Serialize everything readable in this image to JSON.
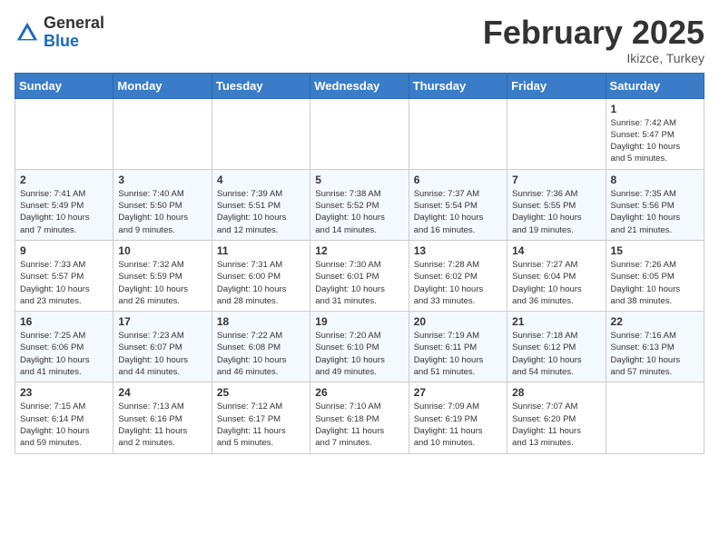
{
  "header": {
    "logo_general": "General",
    "logo_blue": "Blue",
    "month_title": "February 2025",
    "location": "Ikizce, Turkey"
  },
  "weekdays": [
    "Sunday",
    "Monday",
    "Tuesday",
    "Wednesday",
    "Thursday",
    "Friday",
    "Saturday"
  ],
  "weeks": [
    [
      {
        "day": "",
        "info": ""
      },
      {
        "day": "",
        "info": ""
      },
      {
        "day": "",
        "info": ""
      },
      {
        "day": "",
        "info": ""
      },
      {
        "day": "",
        "info": ""
      },
      {
        "day": "",
        "info": ""
      },
      {
        "day": "1",
        "info": "Sunrise: 7:42 AM\nSunset: 5:47 PM\nDaylight: 10 hours\nand 5 minutes."
      }
    ],
    [
      {
        "day": "2",
        "info": "Sunrise: 7:41 AM\nSunset: 5:49 PM\nDaylight: 10 hours\nand 7 minutes."
      },
      {
        "day": "3",
        "info": "Sunrise: 7:40 AM\nSunset: 5:50 PM\nDaylight: 10 hours\nand 9 minutes."
      },
      {
        "day": "4",
        "info": "Sunrise: 7:39 AM\nSunset: 5:51 PM\nDaylight: 10 hours\nand 12 minutes."
      },
      {
        "day": "5",
        "info": "Sunrise: 7:38 AM\nSunset: 5:52 PM\nDaylight: 10 hours\nand 14 minutes."
      },
      {
        "day": "6",
        "info": "Sunrise: 7:37 AM\nSunset: 5:54 PM\nDaylight: 10 hours\nand 16 minutes."
      },
      {
        "day": "7",
        "info": "Sunrise: 7:36 AM\nSunset: 5:55 PM\nDaylight: 10 hours\nand 19 minutes."
      },
      {
        "day": "8",
        "info": "Sunrise: 7:35 AM\nSunset: 5:56 PM\nDaylight: 10 hours\nand 21 minutes."
      }
    ],
    [
      {
        "day": "9",
        "info": "Sunrise: 7:33 AM\nSunset: 5:57 PM\nDaylight: 10 hours\nand 23 minutes."
      },
      {
        "day": "10",
        "info": "Sunrise: 7:32 AM\nSunset: 5:59 PM\nDaylight: 10 hours\nand 26 minutes."
      },
      {
        "day": "11",
        "info": "Sunrise: 7:31 AM\nSunset: 6:00 PM\nDaylight: 10 hours\nand 28 minutes."
      },
      {
        "day": "12",
        "info": "Sunrise: 7:30 AM\nSunset: 6:01 PM\nDaylight: 10 hours\nand 31 minutes."
      },
      {
        "day": "13",
        "info": "Sunrise: 7:28 AM\nSunset: 6:02 PM\nDaylight: 10 hours\nand 33 minutes."
      },
      {
        "day": "14",
        "info": "Sunrise: 7:27 AM\nSunset: 6:04 PM\nDaylight: 10 hours\nand 36 minutes."
      },
      {
        "day": "15",
        "info": "Sunrise: 7:26 AM\nSunset: 6:05 PM\nDaylight: 10 hours\nand 38 minutes."
      }
    ],
    [
      {
        "day": "16",
        "info": "Sunrise: 7:25 AM\nSunset: 6:06 PM\nDaylight: 10 hours\nand 41 minutes."
      },
      {
        "day": "17",
        "info": "Sunrise: 7:23 AM\nSunset: 6:07 PM\nDaylight: 10 hours\nand 44 minutes."
      },
      {
        "day": "18",
        "info": "Sunrise: 7:22 AM\nSunset: 6:08 PM\nDaylight: 10 hours\nand 46 minutes."
      },
      {
        "day": "19",
        "info": "Sunrise: 7:20 AM\nSunset: 6:10 PM\nDaylight: 10 hours\nand 49 minutes."
      },
      {
        "day": "20",
        "info": "Sunrise: 7:19 AM\nSunset: 6:11 PM\nDaylight: 10 hours\nand 51 minutes."
      },
      {
        "day": "21",
        "info": "Sunrise: 7:18 AM\nSunset: 6:12 PM\nDaylight: 10 hours\nand 54 minutes."
      },
      {
        "day": "22",
        "info": "Sunrise: 7:16 AM\nSunset: 6:13 PM\nDaylight: 10 hours\nand 57 minutes."
      }
    ],
    [
      {
        "day": "23",
        "info": "Sunrise: 7:15 AM\nSunset: 6:14 PM\nDaylight: 10 hours\nand 59 minutes."
      },
      {
        "day": "24",
        "info": "Sunrise: 7:13 AM\nSunset: 6:16 PM\nDaylight: 11 hours\nand 2 minutes."
      },
      {
        "day": "25",
        "info": "Sunrise: 7:12 AM\nSunset: 6:17 PM\nDaylight: 11 hours\nand 5 minutes."
      },
      {
        "day": "26",
        "info": "Sunrise: 7:10 AM\nSunset: 6:18 PM\nDaylight: 11 hours\nand 7 minutes."
      },
      {
        "day": "27",
        "info": "Sunrise: 7:09 AM\nSunset: 6:19 PM\nDaylight: 11 hours\nand 10 minutes."
      },
      {
        "day": "28",
        "info": "Sunrise: 7:07 AM\nSunset: 6:20 PM\nDaylight: 11 hours\nand 13 minutes."
      },
      {
        "day": "",
        "info": ""
      }
    ]
  ]
}
